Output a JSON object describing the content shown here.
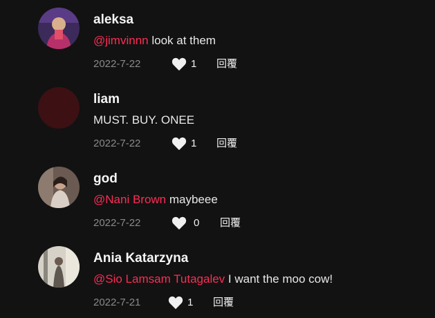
{
  "comments": [
    {
      "username": "aleksa",
      "mention": "@jimvinnn",
      "text": " look at them",
      "date": "2022-7-22",
      "likes": "1",
      "reply_label": "回覆",
      "avatar_colors": [
        "#7a2a55",
        "#b33d7a",
        "#e6c0a0"
      ]
    },
    {
      "username": "liam",
      "mention": "",
      "text": "MUST. BUY. ONEE",
      "date": "2022-7-22",
      "likes": "1",
      "reply_label": "回覆",
      "avatar_colors": [
        "#3a0f12",
        "#4a1216",
        "#3a0f12"
      ]
    },
    {
      "username": "god",
      "mention": "@Nani Brown",
      "text": " maybeee",
      "date": "2022-7-22",
      "likes": "0",
      "reply_label": "回覆",
      "avatar_colors": [
        "#5e4e48",
        "#cbb6a8",
        "#2e2522"
      ]
    },
    {
      "username": "Ania Katarzyna",
      "mention": "@Sio Lamsam Tutagalev",
      "text": " I want the moo cow!",
      "date": "2022-7-21",
      "likes": "1",
      "reply_label": "回覆",
      "avatar_colors": [
        "#c9c6bd",
        "#e3ded2",
        "#6d6a60"
      ]
    }
  ]
}
